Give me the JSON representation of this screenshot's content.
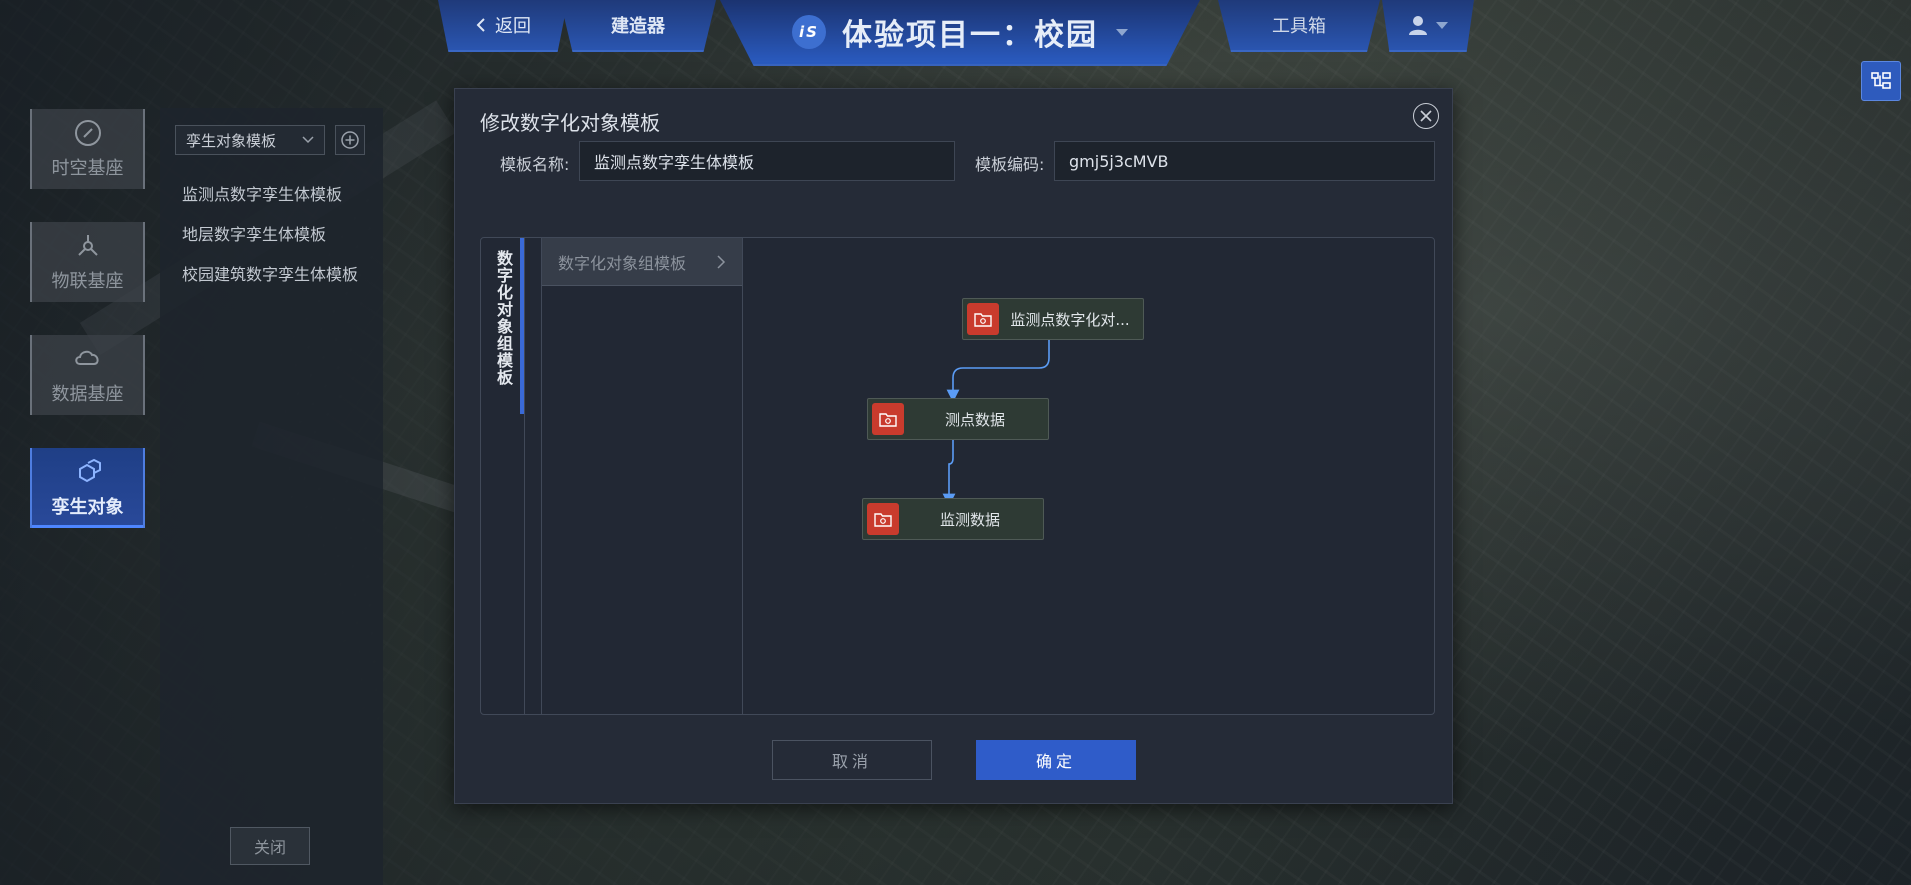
{
  "nav": {
    "back_label": "返回",
    "builder_label": "建造器",
    "logo_text": "iS",
    "project_title": "体验项目一：校园",
    "tools_label": "工具箱"
  },
  "side_menu": [
    {
      "label": "时空基座",
      "icon": "compass-icon"
    },
    {
      "label": "物联基座",
      "icon": "iot-network-icon"
    },
    {
      "label": "数据基座",
      "icon": "cloud-data-icon"
    },
    {
      "label": "孪生对象",
      "icon": "cubes-icon",
      "active": true
    }
  ],
  "template_panel": {
    "select_value": "孪生对象模板",
    "items": [
      "监测点数字孪生体模板",
      "地层数字孪生体模板",
      "校园建筑数字孪生体模板"
    ],
    "close_label": "关闭"
  },
  "modal": {
    "title": "修改数字化对象模板",
    "name_label": "模板名称:",
    "name_value": "监测点数字孪生体模板",
    "code_label": "模板编码:",
    "code_value": "gmj5j3cMVB",
    "vertical_tab": "数字化对象组模板",
    "tree_header": "数字化对象组模板",
    "flow_nodes": [
      "监测点数字化对...",
      "测点数据",
      "监测数据"
    ],
    "cancel_label": "取消",
    "ok_label": "确定"
  },
  "colors": {
    "accent": "#2f5cc9",
    "node_icon": "#c93b2d",
    "node_bg": "#2e3a34",
    "connector": "#5b9cf5"
  }
}
